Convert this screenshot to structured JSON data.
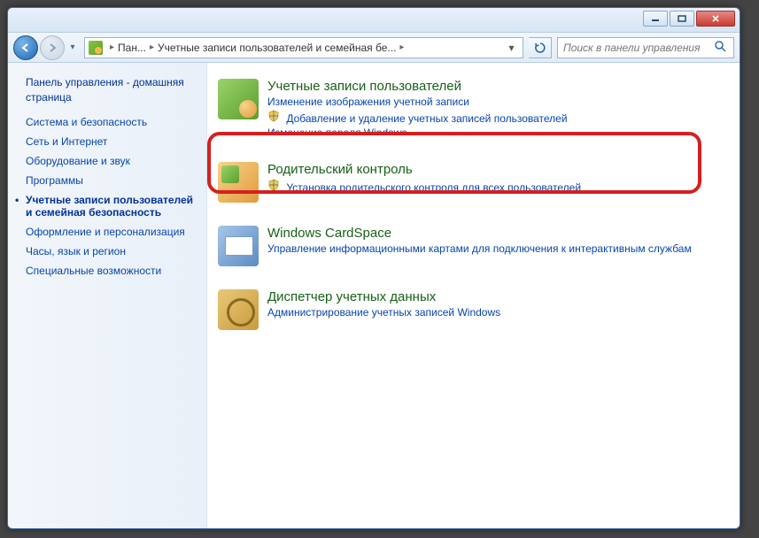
{
  "breadcrumb": {
    "part1": "Пан...",
    "part2": "Учетные записи пользователей и семейная бе..."
  },
  "search": {
    "placeholder": "Поиск в панели управления"
  },
  "sidebar": {
    "home": "Панель управления - домашняя страница",
    "items": [
      "Система и безопасность",
      "Сеть и Интернет",
      "Оборудование и звук",
      "Программы",
      "Учетные записи пользователей и семейная безопасность",
      "Оформление и персонализация",
      "Часы, язык и регион",
      "Специальные возможности"
    ]
  },
  "categories": {
    "users": {
      "title": "Учетные записи пользователей",
      "link1": "Изменение изображения учетной записи",
      "link2": "Добавление и удаление учетных записей пользователей",
      "link3_cut": "Изменение пароля Windows"
    },
    "parental": {
      "title": "Родительский контроль",
      "link1": "Установка родительского контроля для всех пользователей"
    },
    "cardspace": {
      "title": "Windows CardSpace",
      "link1": "Управление информационными картами для подключения к интерактивным службам"
    },
    "cred": {
      "title": "Диспетчер учетных данных",
      "link1": "Администрирование учетных записей Windows"
    }
  }
}
